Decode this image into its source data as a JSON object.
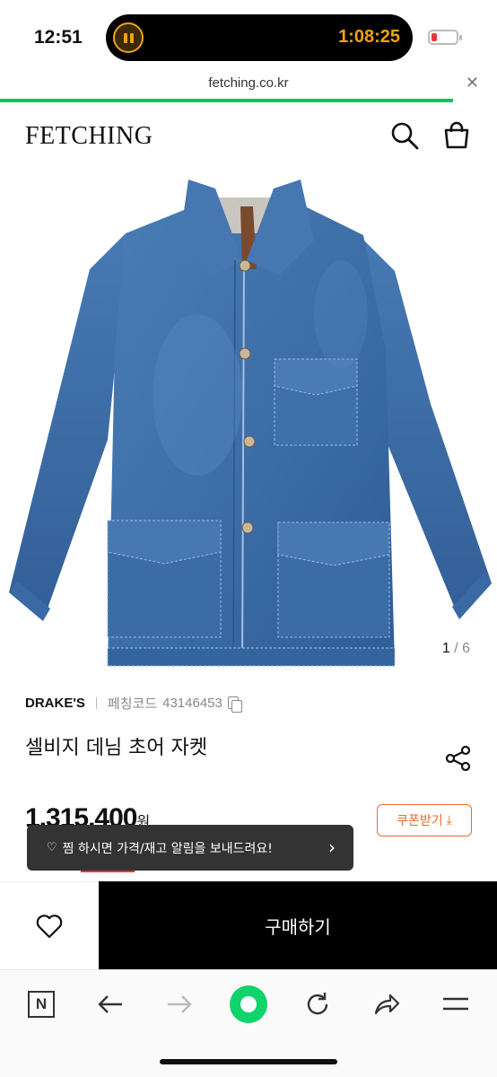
{
  "status_bar": {
    "time": "12:51",
    "timer": "1:08:25"
  },
  "browser": {
    "url": "fetching.co.kr",
    "close_icon": "close-icon"
  },
  "header": {
    "logo": "FETCHING",
    "search_icon": "search-icon",
    "bag_icon": "shopping-bag-icon"
  },
  "gallery": {
    "current": "1",
    "separator": " / ",
    "total": "6"
  },
  "product": {
    "brand": "DRAKE'S",
    "code_label": "페칭코드",
    "code": "43146453",
    "title": "셀비지 데님 초어 자켓",
    "price": "1,315,400",
    "currency": "원",
    "coupon_label": "쿠폰받기"
  },
  "toast": {
    "message": "찜 하시면 가격/재고 알림을 보내드려요!"
  },
  "actions": {
    "buy_label": "구매하기"
  },
  "toolbar": {
    "n_label": "N"
  },
  "colors": {
    "accent_green": "#12c25c",
    "coupon_orange": "#e86c2c",
    "timer_amber": "#f2a20f",
    "denim": "#3c6ea8"
  }
}
